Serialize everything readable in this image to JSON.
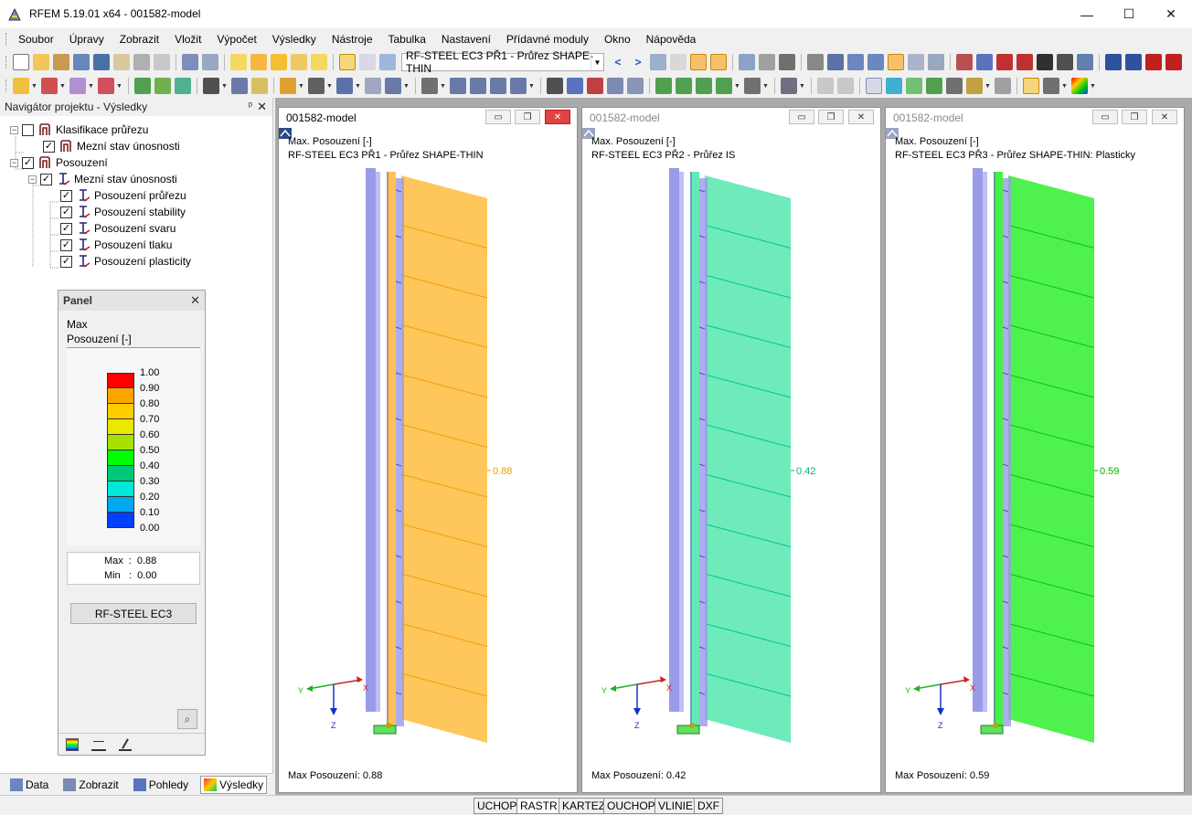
{
  "app": {
    "title": "RFEM 5.19.01 x64 - 001582-model"
  },
  "menu": [
    "Soubor",
    "Úpravy",
    "Zobrazit",
    "Vložit",
    "Výpočet",
    "Výsledky",
    "Nástroje",
    "Tabulka",
    "Nastavení",
    "Přídavné moduly",
    "Okno",
    "Nápověda"
  ],
  "toolbar": {
    "case_combo": "RF-STEEL EC3 PŘ1 - Průřez SHAPE-THIN"
  },
  "navigator": {
    "title": "Navigátor projektu - Výsledky",
    "items": [
      {
        "label": "Klasifikace průřezu",
        "checked": false
      },
      {
        "label": "Mezní stav únosnosti",
        "checked": true
      },
      {
        "label": "Posouzení",
        "checked": true
      },
      {
        "label": "Mezní stav únosnosti",
        "checked": true
      },
      {
        "label": "Posouzení průřezu",
        "checked": true
      },
      {
        "label": "Posouzení stability",
        "checked": true
      },
      {
        "label": "Posouzení svaru",
        "checked": true
      },
      {
        "label": "Posouzení tlaku",
        "checked": true
      },
      {
        "label": "Posouzení plasticity",
        "checked": true
      }
    ],
    "tabs": [
      "Data",
      "Zobrazit",
      "Pohledy",
      "Výsledky"
    ]
  },
  "panel": {
    "title": "Panel",
    "line1": "Max",
    "line2": "Posouzení [-]",
    "scale": [
      {
        "value": "1.00",
        "color": "#ff0000"
      },
      {
        "value": "0.90",
        "color": "#ffa500"
      },
      {
        "value": "0.80",
        "color": "#ffcc00"
      },
      {
        "value": "0.70",
        "color": "#e8e800"
      },
      {
        "value": "0.60",
        "color": "#a8e000"
      },
      {
        "value": "0.50",
        "color": "#00ff00"
      },
      {
        "value": "0.40",
        "color": "#00c878"
      },
      {
        "value": "0.30",
        "color": "#00e8d8"
      },
      {
        "value": "0.20",
        "color": "#00a8f0"
      },
      {
        "value": "0.10",
        "color": "#0040ff"
      },
      {
        "value": "0.00",
        "color": "#0000b0"
      }
    ],
    "max_label": "Max",
    "max_sep": ":",
    "max_value": "0.88",
    "min_label": "Min",
    "min_sep": ":",
    "min_value": "0.00",
    "button": "RF-STEEL EC3"
  },
  "windows": [
    {
      "title": "001582-model",
      "line1": "Max. Posouzení [-]",
      "line2": "RF-STEEL EC3 PŘ1 - Průřez SHAPE-THIN",
      "value": "0.88",
      "footer": "Max Posouzení: 0.88",
      "color": "#ffc04a",
      "line_color": "#f0a000",
      "label_color": "#e8a000",
      "active": true
    },
    {
      "title": "001582-model",
      "line1": "Max. Posouzení [-]",
      "line2": "RF-STEEL EC3 PŘ2 - Průřez IS",
      "value": "0.42",
      "footer": "Max Posouzení: 0.42",
      "color": "#5ee8b4",
      "line_color": "#00c88c",
      "label_color": "#00b478",
      "active": false
    },
    {
      "title": "001582-model",
      "line1": "Max. Posouzení [-]",
      "line2": "RF-STEEL EC3 PŘ3 - Průřez SHAPE-THIN: Plasticky",
      "value": "0.59",
      "footer": "Max Posouzení: 0.59",
      "color": "#3cf03c",
      "line_color": "#00c800",
      "label_color": "#00b400",
      "active": false
    }
  ],
  "axes": {
    "y": "Y",
    "x": "X",
    "z": "Z"
  },
  "status": [
    "UCHOP",
    "RASTR",
    "KARTEZ",
    "OUCHOP",
    "VLINIE",
    "DXF"
  ]
}
